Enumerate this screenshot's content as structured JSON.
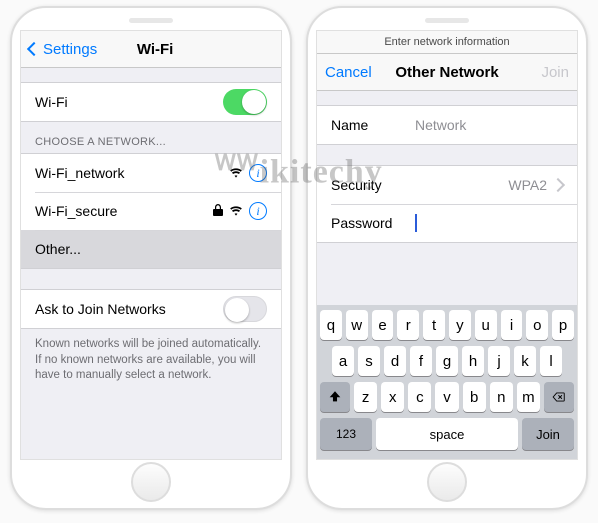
{
  "watermark": "Wikitechy",
  "left": {
    "nav": {
      "back": "Settings",
      "title": "Wi-Fi"
    },
    "wifi_toggle": {
      "label": "Wi-Fi",
      "on": true
    },
    "choose_header": "CHOOSE A NETWORK...",
    "networks": [
      {
        "name": "Wi-Fi_network",
        "locked": false
      },
      {
        "name": "Wi-Fi_secure",
        "locked": true
      }
    ],
    "other_label": "Other...",
    "ask_join": {
      "label": "Ask to Join Networks",
      "on": false
    },
    "footer": "Known networks will be joined automatically. If no known networks are available, you will have to manually select a network."
  },
  "right": {
    "subheader": "Enter network information",
    "nav": {
      "cancel": "Cancel",
      "title": "Other Network",
      "join": "Join"
    },
    "fields": {
      "name_label": "Name",
      "name_placeholder": "Network",
      "security_label": "Security",
      "security_value": "WPA2",
      "password_label": "Password",
      "password_value": ""
    },
    "keyboard": {
      "row1": [
        "q",
        "w",
        "e",
        "r",
        "t",
        "y",
        "u",
        "i",
        "o",
        "p"
      ],
      "row2": [
        "a",
        "s",
        "d",
        "f",
        "g",
        "h",
        "j",
        "k",
        "l"
      ],
      "row3": [
        "z",
        "x",
        "c",
        "v",
        "b",
        "n",
        "m"
      ],
      "numkey": "123",
      "space": "space",
      "join": "Join"
    }
  }
}
